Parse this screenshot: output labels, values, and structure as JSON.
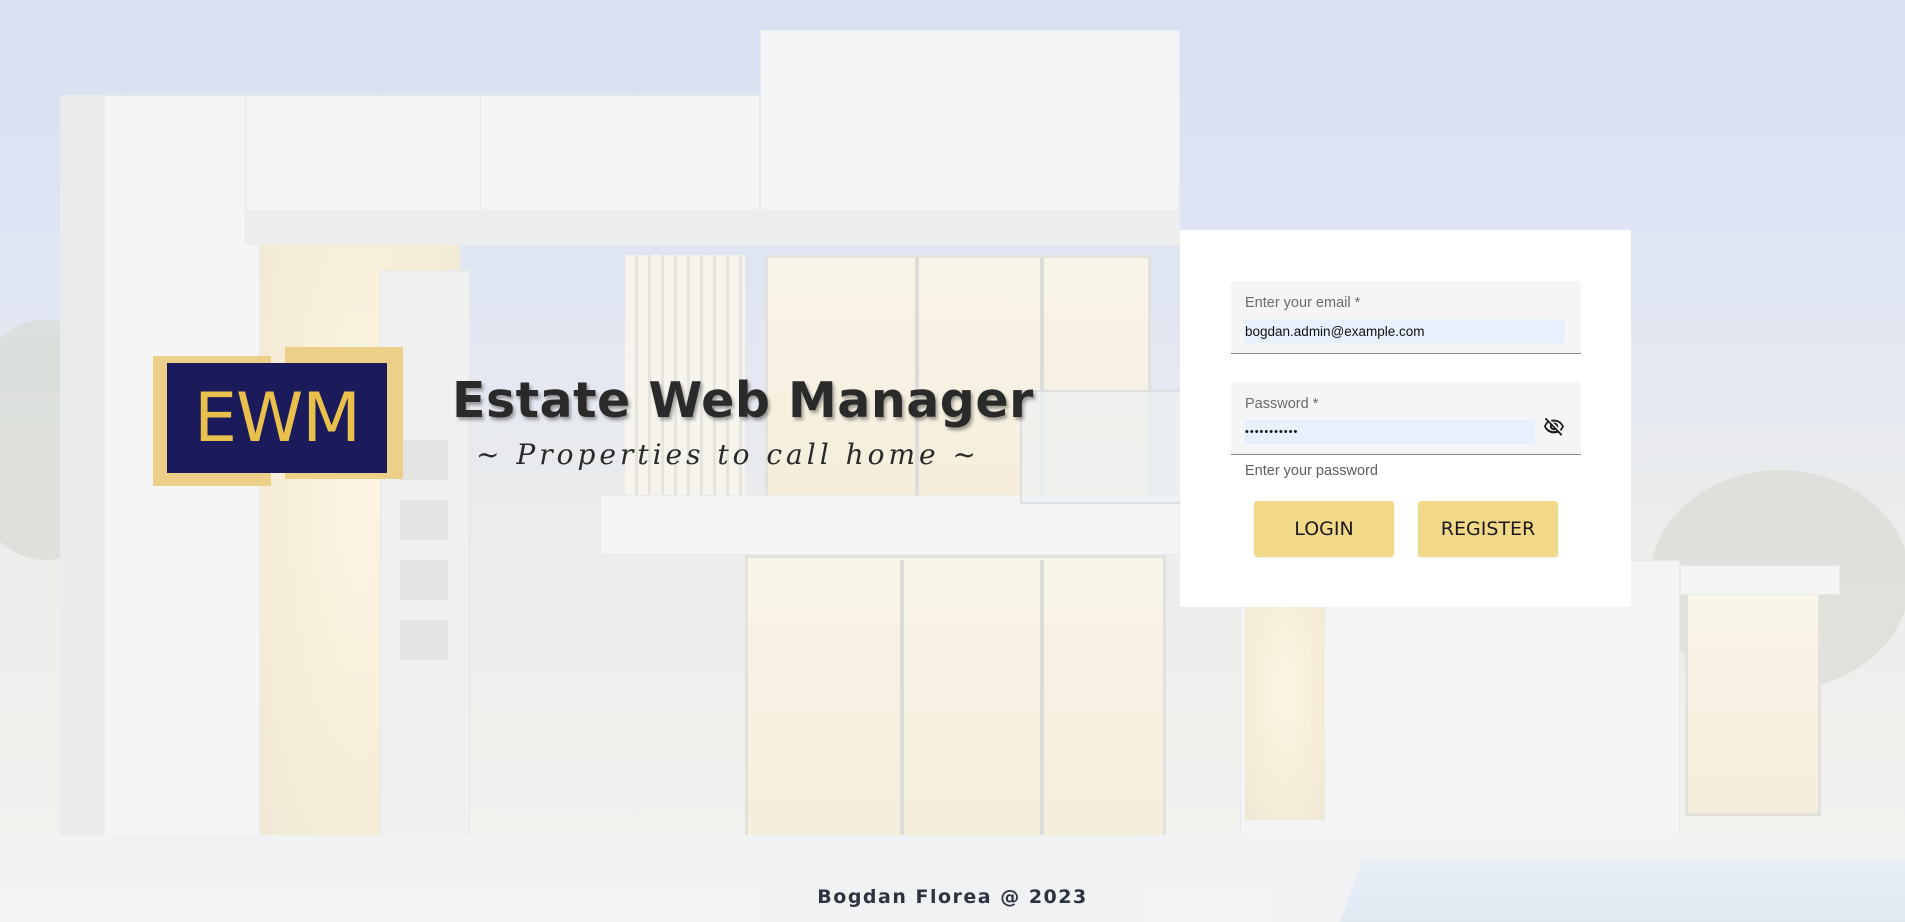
{
  "brand": {
    "logo_text": "EWM",
    "title": "Estate Web Manager",
    "tagline": "~ Properties to call home ~",
    "logo_bg_color": "#1b1b5c",
    "logo_accent_color": "#e9c04c"
  },
  "login_form": {
    "email": {
      "label": "Enter your email *",
      "value": "bogdan.admin@example.com"
    },
    "password": {
      "label": "Password *",
      "value": "•••••••••••",
      "hint": "Enter your password",
      "toggle_icon": "visibility-off-icon"
    },
    "buttons": {
      "login": "LOGIN",
      "register": "REGISTER"
    },
    "button_color": "#f2d98a"
  },
  "footer": {
    "text": "Bogdan Florea @ 2023"
  }
}
